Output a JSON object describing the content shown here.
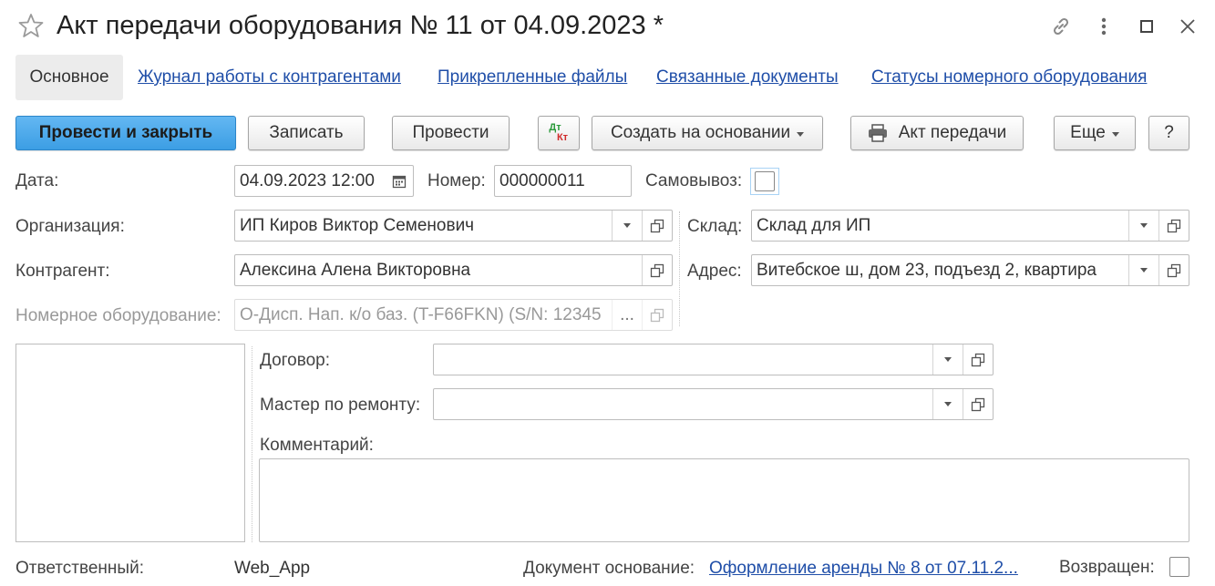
{
  "window": {
    "title": "Акт передачи оборудования № 11 от 04.09.2023 *"
  },
  "tabs": {
    "active": "Основное",
    "links": [
      "Журнал работы с контрагентами",
      "Прикрепленные файлы",
      "Связанные документы",
      "Статусы номерного оборудования"
    ]
  },
  "toolbar": {
    "post_close": "Провести и закрыть",
    "save": "Записать",
    "post": "Провести",
    "dtkt_top": "Дт",
    "dtkt_bottom": "Кт",
    "create_based": "Создать на основании",
    "print_act": "Акт передачи",
    "more": "Еще",
    "help": "?"
  },
  "form": {
    "date_label": "Дата:",
    "date_value": "04.09.2023 12:00",
    "number_label": "Номер:",
    "number_value": "000000011",
    "pickup_label": "Самовывоз:",
    "org_label": "Организация:",
    "org_value": "ИП Киров Виктор Семенович",
    "warehouse_label": "Склад:",
    "warehouse_value": "Склад для ИП",
    "counterparty_label": "Контрагент:",
    "counterparty_value": "Алексина Алена Викторовна",
    "address_label": "Адрес:",
    "address_value": "Витебское ш,  дом 23,  подъезд 2,  квартира",
    "equipment_label": "Номерное оборудование:",
    "equipment_value": "О-Дисп. Нап. к/о баз. (T-F66FKN) (S/N: 12345",
    "equipment_more": "...",
    "contract_label": "Договор:",
    "contract_value": "",
    "master_label": "Мастер по ремонту:",
    "master_value": "",
    "comment_label": "Комментарий:",
    "comment_value": "",
    "responsible_label": "Ответственный:",
    "responsible_value": "Web_App",
    "base_doc_label": "Документ основание:",
    "base_doc_value": "Оформление аренды № 8 от 07.11.2...",
    "returned_label": "Возвращен:"
  },
  "colors": {
    "primary_button": "#4aa8ec",
    "link": "#1f4ea8",
    "dt": "#2a9a3a",
    "kt": "#d02a2a"
  }
}
